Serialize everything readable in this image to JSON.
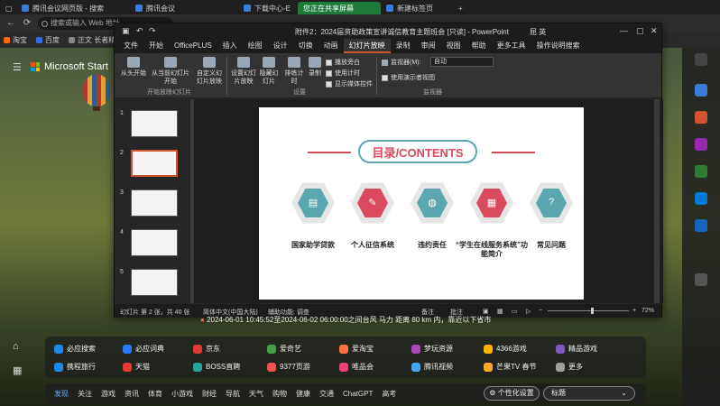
{
  "browser": {
    "tabs": [
      {
        "label": "腾讯会议网页版 - 搜索"
      },
      {
        "label": "腾讯会议"
      },
      {
        "label": "下载中心-E"
      },
      {
        "label": "您正在共享屏幕"
      },
      {
        "label": "新建标签页"
      }
    ],
    "address_placeholder": "搜索或输入 Web 地址",
    "favorites": [
      {
        "label": "淘宝",
        "color": "#ff6a00"
      },
      {
        "label": "百度",
        "color": "#2f6fe0"
      },
      {
        "label": "正文 长者精助",
        "color": "#888888"
      }
    ]
  },
  "desktop": {
    "brand": "Microsoft Start",
    "quake_text": "2024-06-01 10:45:52至2024-06-02 06:00:00之间台风 马力 距离 80 km 内，靠近以下省市"
  },
  "ppt": {
    "doc_title": "附件2：2024届资助政策宣讲诚信教育主题班会 [只读] - PowerPoint",
    "user": "屈 英",
    "menu": [
      "文件",
      "开始",
      "OfficePLUS",
      "插入",
      "绘图",
      "设计",
      "切换",
      "动画",
      "幻灯片放映",
      "录制",
      "审阅",
      "视图",
      "帮助",
      "更多工具",
      "操作说明搜索"
    ],
    "active_menu": "幻灯片放映",
    "ribbon": {
      "from_start": "从头开始",
      "from_current": "从当前幻灯片开始",
      "custom": "自定义幻灯片放映",
      "group_start": "开始放映幻灯片",
      "setup": "设置幻灯片放映",
      "hide": "隐藏幻灯片",
      "rehearse": "排练计时",
      "record": "录制",
      "group_setup": "设置",
      "chk_narration": "播放旁白",
      "chk_timing": "使用计时",
      "chk_controls": "显示媒体控件",
      "monitor_label": "监视器(M):",
      "monitor_value": "自动",
      "chk_presenter": "使用演示者视图",
      "group_monitor": "监视器"
    },
    "slide_numbers": [
      "1",
      "2",
      "3",
      "4",
      "5"
    ],
    "slide": {
      "title": "目录/CONTENTS",
      "items": [
        {
          "label": "国家助学贷款",
          "color": "#5aa7b0"
        },
        {
          "label": "个人征信系统",
          "color": "#d94b5c"
        },
        {
          "label": "违约责任",
          "color": "#5aa7b0"
        },
        {
          "label": "“学生在线服务系统”功能简介",
          "color": "#d94b5c"
        },
        {
          "label": "常见问题",
          "color": "#5aa7b0"
        }
      ]
    },
    "status": {
      "slide_info": "幻灯片 第 2 张，共 40 张",
      "language": "简体中文(中国大陆)",
      "accessibility": "辅助功能: 调查",
      "notes": "备注",
      "comments": "批注",
      "zoom": "72%"
    },
    "colors": {
      "accent": "#d35230",
      "teal": "#5aa7b0",
      "red": "#d94b5c"
    }
  },
  "quick_links": [
    {
      "label": "必应搜索",
      "color": "#1e88e5"
    },
    {
      "label": "必应词典",
      "color": "#2979ff"
    },
    {
      "label": "京东",
      "color": "#e53935"
    },
    {
      "label": "爱奇艺",
      "color": "#43a047"
    },
    {
      "label": "爱淘宝",
      "color": "#ff7043"
    },
    {
      "label": "梦玩资源",
      "color": "#ab47bc"
    },
    {
      "label": "4366游戏",
      "color": "#ffb300"
    },
    {
      "label": "精品游戏",
      "color": "#7e57c2"
    },
    {
      "label": "携程旅行",
      "color": "#1e88e5"
    },
    {
      "label": "天猫",
      "color": "#e53935"
    },
    {
      "label": "BOSS直聘",
      "color": "#26a69a"
    },
    {
      "label": "9377页游",
      "color": "#ef5350"
    },
    {
      "label": "唯品会",
      "color": "#ec407a"
    },
    {
      "label": "腾讯视频",
      "color": "#42a5f5"
    },
    {
      "label": "芒果TV 春节",
      "color": "#ffa726"
    },
    {
      "label": "更多",
      "color": "#9e9e9e"
    }
  ],
  "bottom_tabs": [
    "发现",
    "关注",
    "游戏",
    "资讯",
    "体育",
    "小游戏",
    "财经",
    "导航",
    "天气",
    "购物",
    "健康",
    "交通",
    "ChatGPT",
    "高考"
  ],
  "bottom_active": "发现",
  "personalize": "个性化设置",
  "select_value": "标题"
}
